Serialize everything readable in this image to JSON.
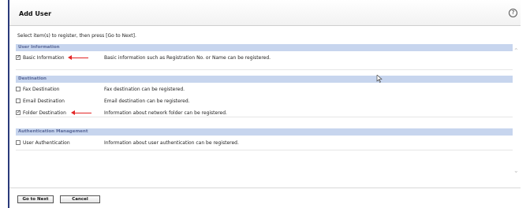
{
  "header": {
    "title": "Add User",
    "help_icon": "?"
  },
  "instruction": "Select item(s) to register, then press [Go to Next].",
  "sections": [
    {
      "title": "User Information",
      "items": [
        {
          "label": "Basic Information",
          "checked": true,
          "description": "Basic information such as Registration No. or Name can be registered."
        }
      ]
    },
    {
      "title": "Destination",
      "items": [
        {
          "label": "Fax Destination",
          "checked": false,
          "description": "Fax destination can be registered."
        },
        {
          "label": "Email Destination",
          "checked": false,
          "description": "Email destination can be registered."
        },
        {
          "label": "Folder Destination",
          "checked": true,
          "description": "Information about network folder can be registered."
        }
      ]
    },
    {
      "title": "Authentication Management",
      "items": [
        {
          "label": "User Authentication",
          "checked": false,
          "description": "Information about user authentication can be registered."
        }
      ]
    }
  ],
  "buttons": {
    "next": "Go to Next",
    "cancel": "Cancel"
  },
  "colors": {
    "section_bg": "#c7d5ee",
    "section_text": "#5b6a9a",
    "arrow": "#e32626",
    "accent_rule": "#2b3a7a"
  }
}
